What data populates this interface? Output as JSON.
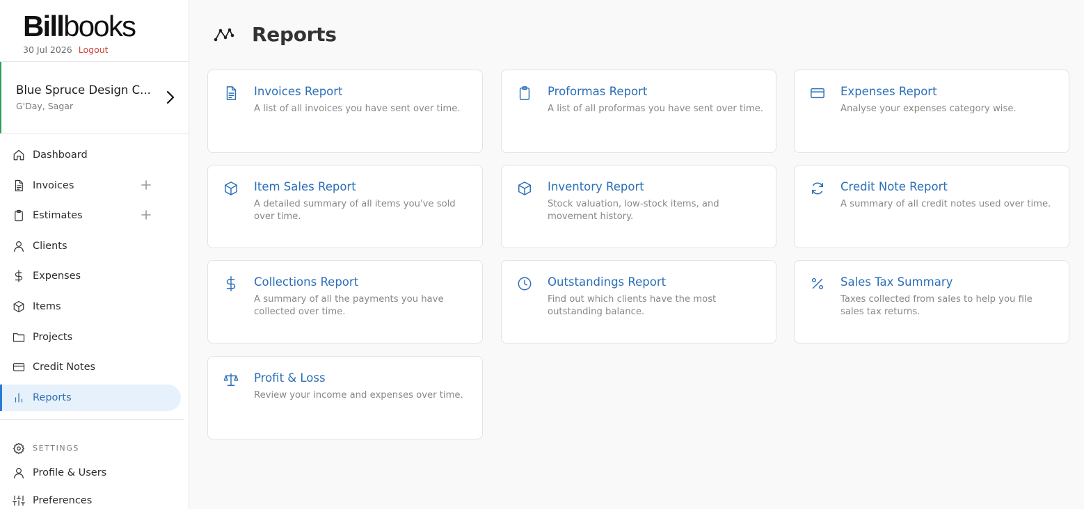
{
  "brand": {
    "logo_bold": "Bill",
    "logo_light": "books",
    "date": "30 Jul 2026",
    "logout_label": "Logout"
  },
  "company": {
    "name": "Blue Spruce Design C...",
    "greeting": "G'Day, Sagar"
  },
  "nav": {
    "dashboard": "Dashboard",
    "invoices": "Invoices",
    "estimates": "Estimates",
    "clients": "Clients",
    "expenses": "Expenses",
    "items": "Items",
    "projects": "Projects",
    "credit_notes": "Credit Notes",
    "reports": "Reports"
  },
  "settings": {
    "heading": "SETTINGS",
    "profile": "Profile & Users",
    "preferences": "Preferences"
  },
  "page": {
    "title": "Reports"
  },
  "reports": [
    {
      "icon": "document-icon",
      "title": "Invoices Report",
      "desc": "A list of all invoices you have sent over time."
    },
    {
      "icon": "clipboard-icon",
      "title": "Proformas Report",
      "desc": "A list of all proformas you have sent over time."
    },
    {
      "icon": "credit-card-icon",
      "title": "Expenses Report",
      "desc": "Analyse your expenses category wise."
    },
    {
      "icon": "box-icon",
      "title": "Item Sales Report",
      "desc": "A detailed summary of all items you've sold over time."
    },
    {
      "icon": "box-icon",
      "title": "Inventory Report",
      "desc": "Stock valuation, low-stock items, and movement history."
    },
    {
      "icon": "refresh-icon",
      "title": "Credit Note Report",
      "desc": "A summary of all credit notes used over time."
    },
    {
      "icon": "dollar-icon",
      "title": "Collections Report",
      "desc": "A summary of all the payments you have collected over time."
    },
    {
      "icon": "clock-icon",
      "title": "Outstandings Report",
      "desc": "Find out which clients have the most outstanding balance."
    },
    {
      "icon": "percent-icon",
      "title": "Sales Tax Summary",
      "desc": "Taxes collected from sales to help you file sales tax returns."
    },
    {
      "icon": "scale-icon",
      "title": "Profit & Loss",
      "desc": "Review your income and expenses over time."
    }
  ],
  "colors": {
    "accent": "#2b6fb8",
    "active_bg": "#e7f1fb",
    "logout": "#d0453b",
    "company_bar": "#2f9e57"
  }
}
